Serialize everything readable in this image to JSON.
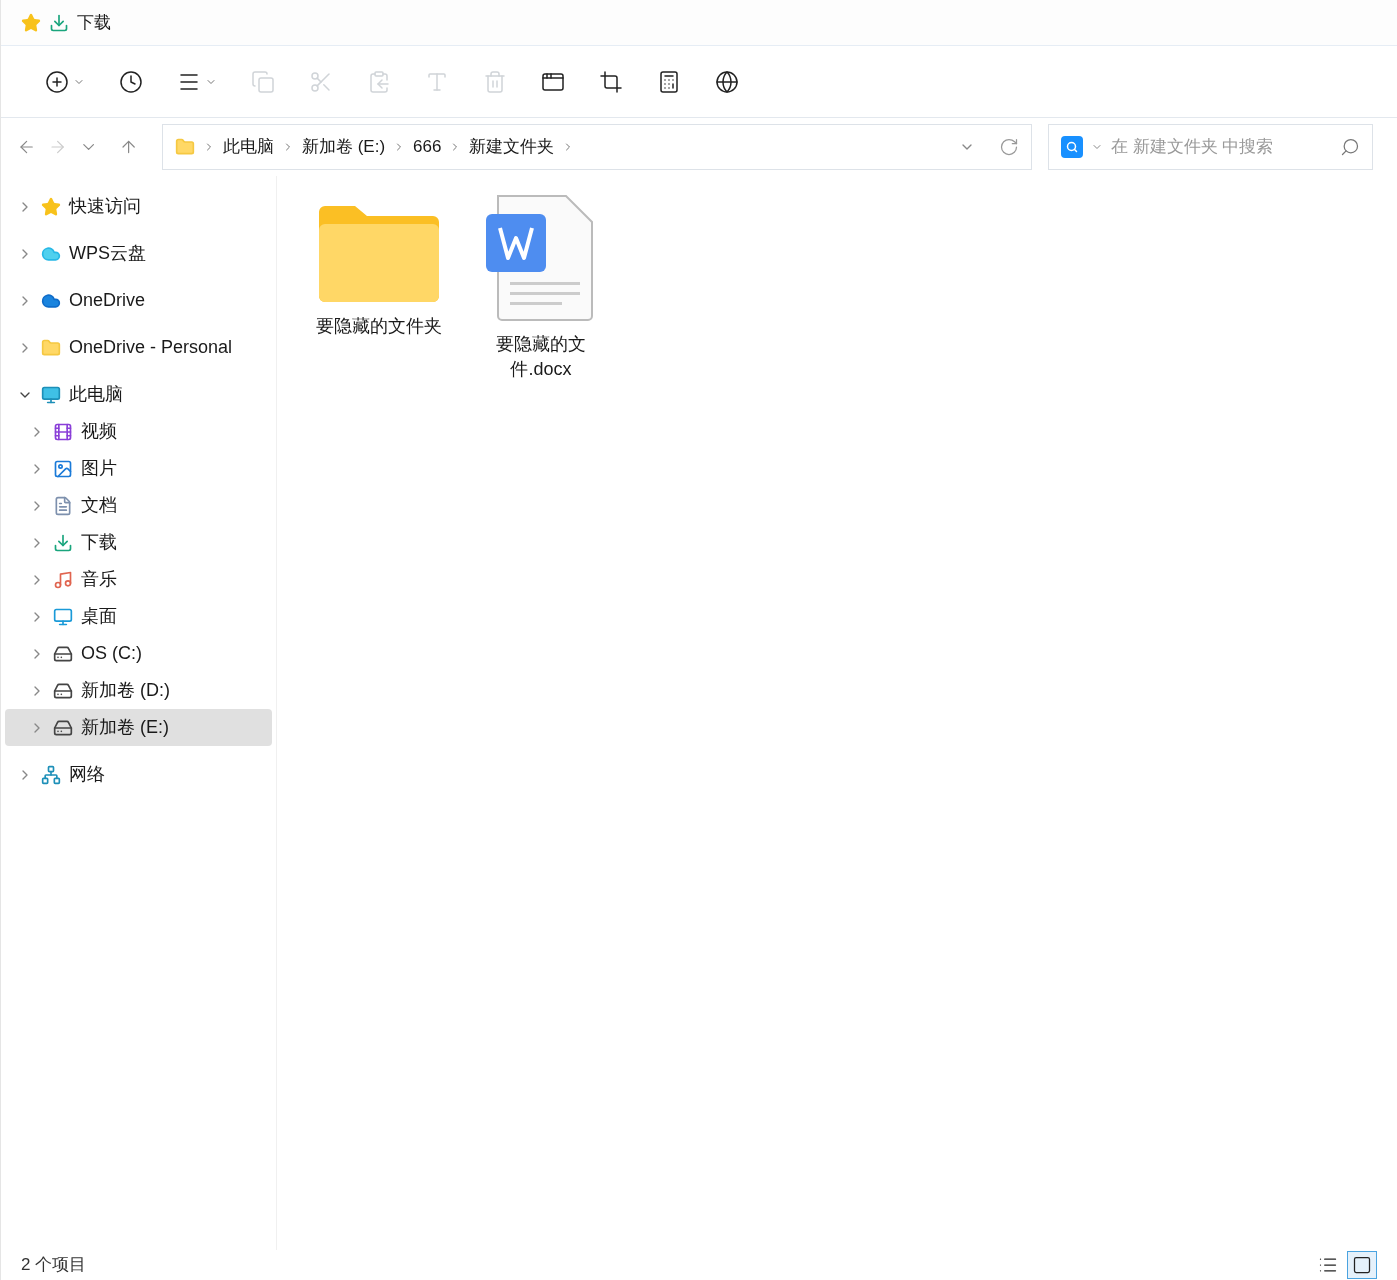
{
  "tab": {
    "title": "下载"
  },
  "toolbar": [
    {
      "kind": "new",
      "disabled": false,
      "dropdown": true
    },
    {
      "kind": "recent",
      "disabled": false,
      "dropdown": false
    },
    {
      "kind": "view",
      "disabled": false,
      "dropdown": true
    },
    {
      "kind": "copy",
      "disabled": true,
      "dropdown": false
    },
    {
      "kind": "cut",
      "disabled": true,
      "dropdown": false
    },
    {
      "kind": "paste",
      "disabled": true,
      "dropdown": false
    },
    {
      "kind": "rename",
      "disabled": true,
      "dropdown": false
    },
    {
      "kind": "delete",
      "disabled": true,
      "dropdown": false
    },
    {
      "kind": "new-window",
      "disabled": false,
      "dropdown": false
    },
    {
      "kind": "crop",
      "disabled": false,
      "dropdown": false
    },
    {
      "kind": "calculator",
      "disabled": false,
      "dropdown": false
    },
    {
      "kind": "browser",
      "disabled": false,
      "dropdown": false
    }
  ],
  "nav": {
    "back_disabled": false,
    "forward_disabled": true
  },
  "address": {
    "crumbs": [
      "此电脑",
      "新加卷 (E:)",
      "666",
      "新建文件夹"
    ]
  },
  "search": {
    "placeholder": "在 新建文件夹 中搜索"
  },
  "sidebar": {
    "items": [
      {
        "kind": "star",
        "label": "快速访问",
        "expanded": false,
        "selected": false
      },
      {
        "kind": "wps-cloud",
        "label": "WPS云盘",
        "expanded": false,
        "selected": false
      },
      {
        "kind": "cloud",
        "label": "OneDrive",
        "expanded": false,
        "selected": false
      },
      {
        "kind": "folder",
        "label": "OneDrive - Personal",
        "expanded": false,
        "selected": false
      },
      {
        "kind": "monitor",
        "label": "此电脑",
        "expanded": true,
        "selected": false,
        "children": [
          {
            "kind": "video",
            "label": "视频",
            "expanded": false,
            "selected": false
          },
          {
            "kind": "image",
            "label": "图片",
            "expanded": false,
            "selected": false
          },
          {
            "kind": "document",
            "label": "文档",
            "expanded": false,
            "selected": false
          },
          {
            "kind": "download",
            "label": "下载",
            "expanded": false,
            "selected": false
          },
          {
            "kind": "music",
            "label": "音乐",
            "expanded": false,
            "selected": false
          },
          {
            "kind": "desktop",
            "label": "桌面",
            "expanded": false,
            "selected": false
          },
          {
            "kind": "os-drive",
            "label": "OS (C:)",
            "expanded": false,
            "selected": false
          },
          {
            "kind": "drive",
            "label": "新加卷 (D:)",
            "expanded": false,
            "selected": false
          },
          {
            "kind": "drive",
            "label": "新加卷 (E:)",
            "expanded": false,
            "selected": true
          }
        ]
      },
      {
        "kind": "network",
        "label": "网络",
        "expanded": false,
        "selected": false
      }
    ]
  },
  "files": [
    {
      "kind": "folder",
      "name": "要隐藏的文件夹"
    },
    {
      "kind": "docx",
      "name": "要隐藏的文件.docx"
    }
  ],
  "status_bar": {
    "count": "2 个项目",
    "views": [
      {
        "kind": "details",
        "selected": false
      },
      {
        "kind": "large-icons",
        "selected": true
      }
    ]
  }
}
